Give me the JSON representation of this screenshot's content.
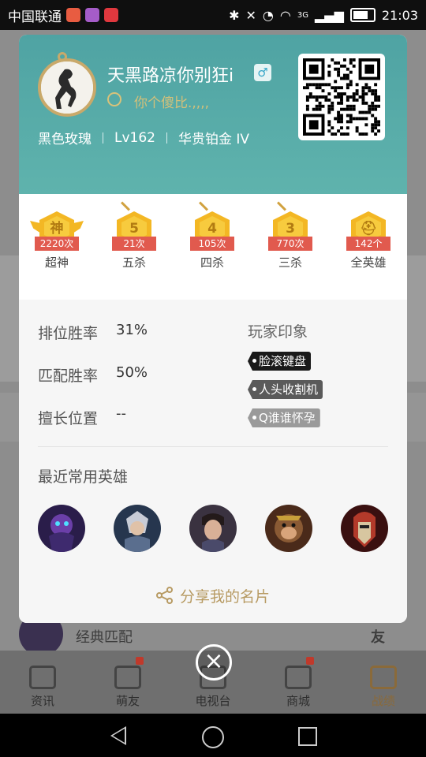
{
  "status_bar": {
    "carrier": "中国联通",
    "network": "3G",
    "time": "21:03"
  },
  "background": {
    "mode_text": "经典匹配",
    "friend_text": "友"
  },
  "bottom_nav": [
    {
      "label": "资讯",
      "icon": "news-icon",
      "badge": false
    },
    {
      "label": "萌友",
      "icon": "friends-icon",
      "badge": true
    },
    {
      "label": "电视台",
      "icon": "tv-icon",
      "badge": false
    },
    {
      "label": "商城",
      "icon": "shop-icon",
      "badge": true
    },
    {
      "label": "战绩",
      "icon": "record-icon",
      "badge": false,
      "active": true
    }
  ],
  "profile": {
    "nickname": "天黑路凉你别狂i",
    "gender_symbol": "♂",
    "signature": "你个傻比.,,,,",
    "title": "黑色玫瑰",
    "level": "Lv162",
    "rank": "华贵铂金 IV"
  },
  "achievements": [
    {
      "label": "超神",
      "count": "2220次",
      "glyph": "神"
    },
    {
      "label": "五杀",
      "count": "21次",
      "glyph": "5"
    },
    {
      "label": "四杀",
      "count": "105次",
      "glyph": "4"
    },
    {
      "label": "三杀",
      "count": "770次",
      "glyph": "3"
    },
    {
      "label": "全英雄",
      "count": "142个",
      "glyph": "⛑"
    }
  ],
  "stats": {
    "ranked_winrate_label": "排位胜率",
    "ranked_winrate": "31%",
    "match_winrate_label": "匹配胜率",
    "match_winrate": "50%",
    "position_label": "擅长位置",
    "position": "--"
  },
  "impressions": {
    "title": "玩家印象",
    "tags": [
      {
        "text": "脸滚键盘",
        "color": "#1a1a1a"
      },
      {
        "text": "人头收割机",
        "color": "#5a5a5a"
      },
      {
        "text": "Q谁谁怀孕",
        "color": "#9a9a9a"
      }
    ]
  },
  "recent_heroes": {
    "title": "最近常用英雄"
  },
  "share_label": "分享我的名片",
  "colors": {
    "header_teal": "#5fb3ad",
    "gold": "#f3b724",
    "ribbon_red": "#e15a4e",
    "share_gold": "#b79a62"
  }
}
